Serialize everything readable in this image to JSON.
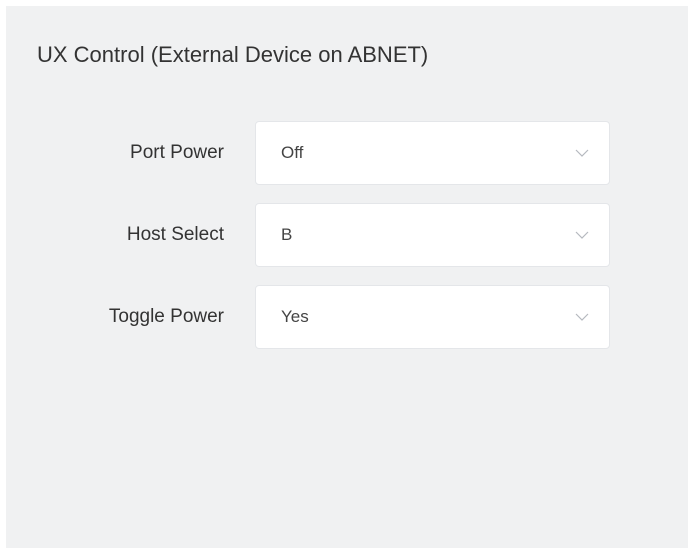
{
  "panel": {
    "title": "UX Control (External Device on ABNET)"
  },
  "fields": [
    {
      "label": "Port Power",
      "value": "Off",
      "icon": "chevron-down-icon"
    },
    {
      "label": "Host Select",
      "value": "B",
      "icon": "chevron-down-icon"
    },
    {
      "label": "Toggle Power",
      "value": "Yes",
      "icon": "chevron-down-icon"
    }
  ],
  "colors": {
    "panel_background": "#f0f1f2",
    "select_background": "#ffffff",
    "text": "#333333",
    "chevron": "#b5b9bf"
  }
}
